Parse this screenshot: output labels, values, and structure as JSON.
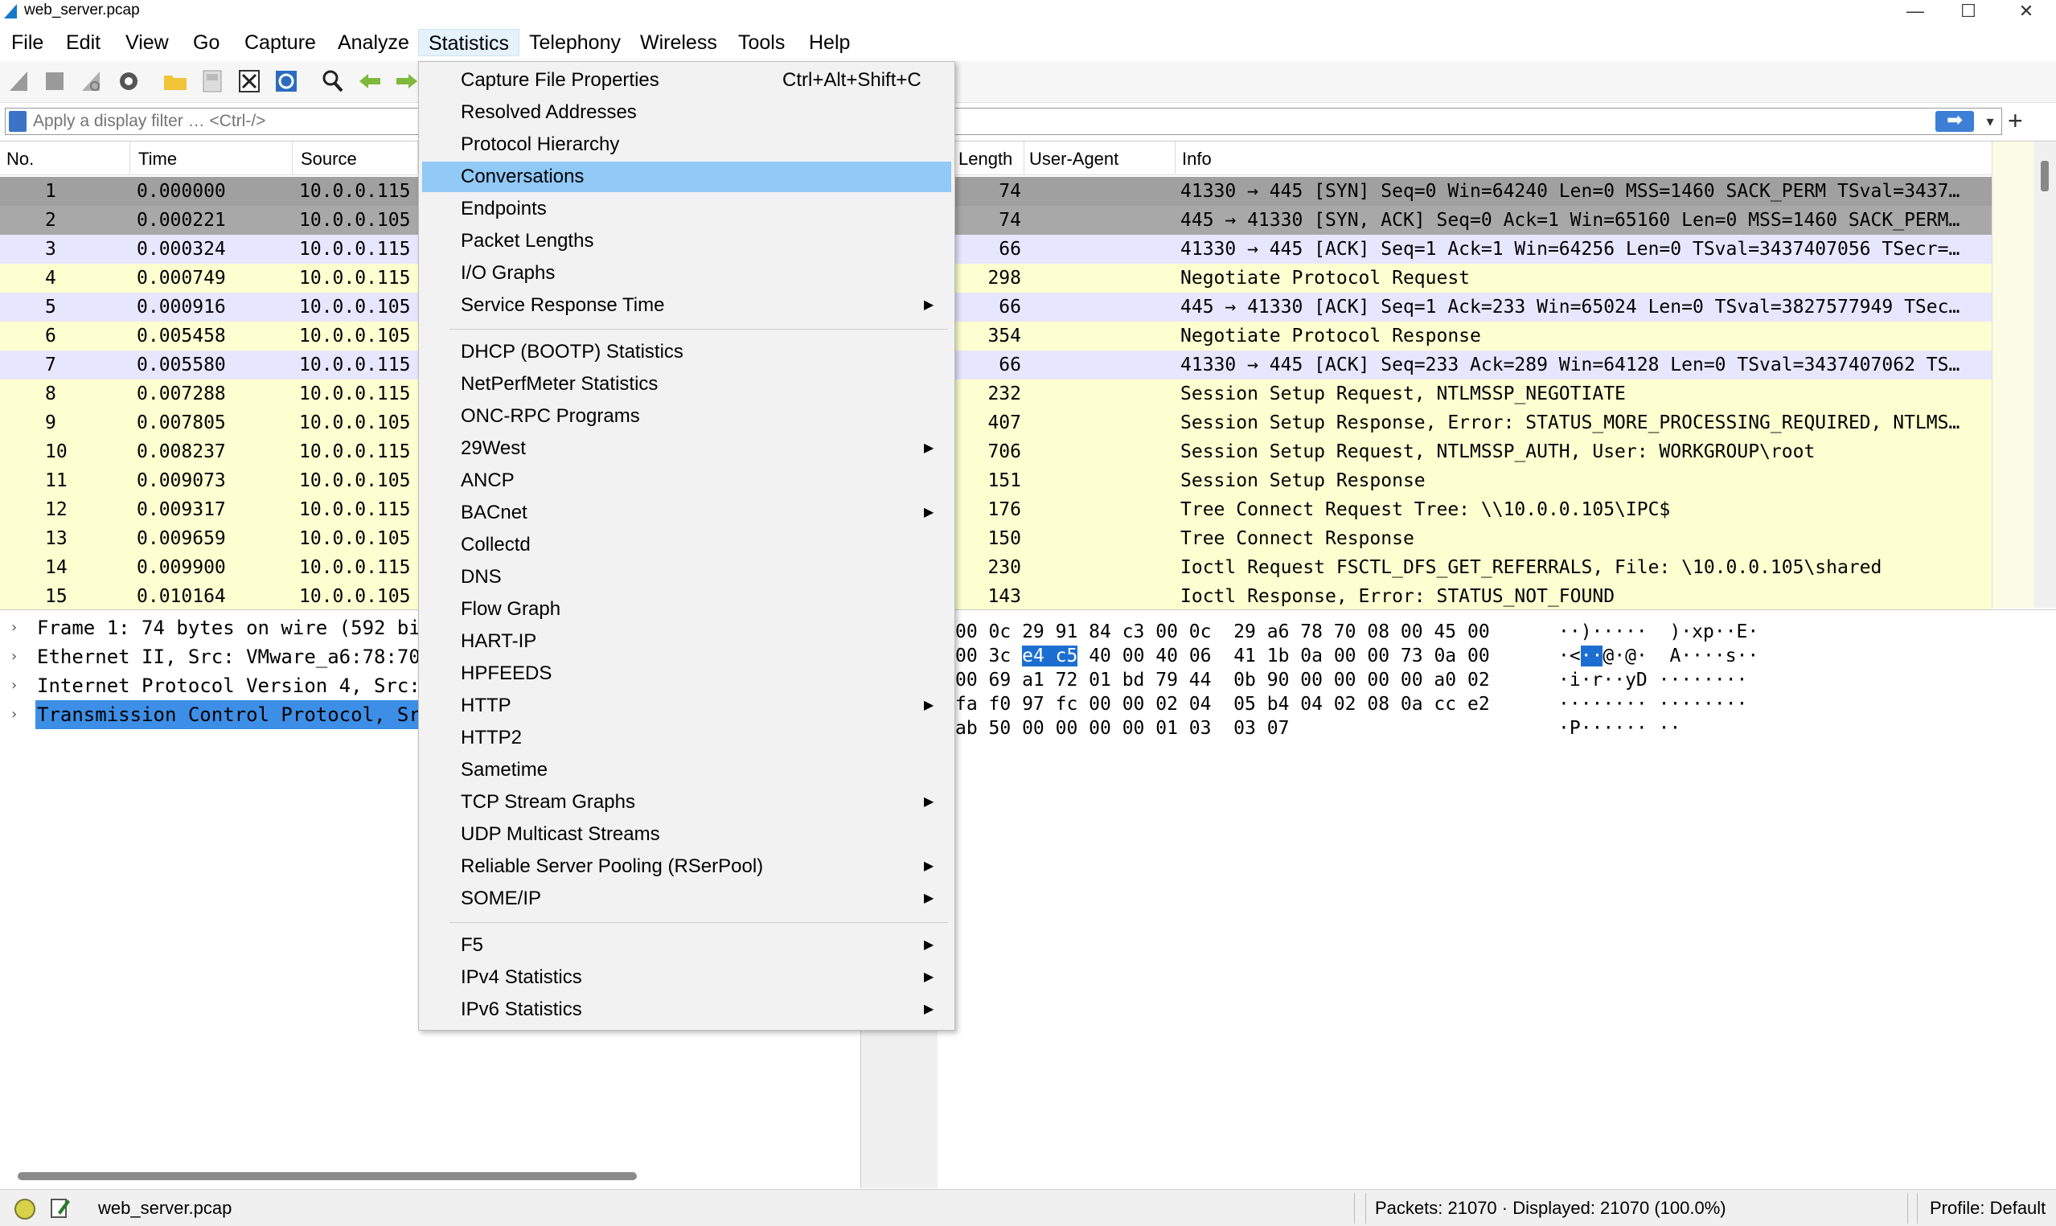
{
  "window": {
    "title": "web_server.pcap",
    "controls": {
      "minimize": "—",
      "maximize": "☐",
      "close": "✕"
    }
  },
  "menubar": [
    "File",
    "Edit",
    "View",
    "Go",
    "Capture",
    "Analyze",
    "Statistics",
    "Telephony",
    "Wireless",
    "Tools",
    "Help"
  ],
  "toolbar_icons": [
    "shark-fin-start-icon",
    "stop-icon",
    "restart-icon",
    "options-gear-icon",
    "open-folder-icon",
    "save-file-icon",
    "close-file-icon",
    "reload-icon",
    "find-magnifier-icon",
    "go-back-arrow-icon",
    "go-forward-arrow-icon"
  ],
  "filter": {
    "placeholder": "Apply a display filter … <Ctrl-/>",
    "apply_icon": "arrow-right-icon",
    "plus": "+"
  },
  "packet_list": {
    "columns": {
      "no": "No.",
      "time": "Time",
      "source": "Source",
      "length": "Length",
      "user_agent": "User-Agent",
      "info": "Info"
    },
    "rows": [
      {
        "no": "1",
        "time": "0.000000",
        "source": "10.0.0.115",
        "length": "74",
        "info": "41330 → 445 [SYN] Seq=0 Win=64240 Len=0 MSS=1460 SACK_PERM TSval=3437…",
        "style": "sel"
      },
      {
        "no": "2",
        "time": "0.000221",
        "source": "10.0.0.105",
        "length": "74",
        "info": "445 → 41330 [SYN, ACK] Seq=0 Ack=1 Win=65160 Len=0 MSS=1460 SACK_PERM…",
        "style": "sel2"
      },
      {
        "no": "3",
        "time": "0.000324",
        "source": "10.0.0.115",
        "length": "66",
        "info": "41330 → 445 [ACK] Seq=1 Ack=1 Win=64256 Len=0 TSval=3437407056 TSecr=…",
        "style": "tcp"
      },
      {
        "no": "4",
        "time": "0.000749",
        "source": "10.0.0.115",
        "length": "298",
        "info": "Negotiate Protocol Request",
        "style": "smb"
      },
      {
        "no": "5",
        "time": "0.000916",
        "source": "10.0.0.105",
        "length": "66",
        "info": "445 → 41330 [ACK] Seq=1 Ack=233 Win=65024 Len=0 TSval=3827577949 TSec…",
        "style": "tcp"
      },
      {
        "no": "6",
        "time": "0.005458",
        "source": "10.0.0.105",
        "length": "354",
        "info": "Negotiate Protocol Response",
        "style": "smb"
      },
      {
        "no": "7",
        "time": "0.005580",
        "source": "10.0.0.115",
        "length": "66",
        "info": "41330 → 445 [ACK] Seq=233 Ack=289 Win=64128 Len=0 TSval=3437407062 TS…",
        "style": "tcp"
      },
      {
        "no": "8",
        "time": "0.007288",
        "source": "10.0.0.115",
        "length": "232",
        "info": "Session Setup Request, NTLMSSP_NEGOTIATE",
        "style": "smb"
      },
      {
        "no": "9",
        "time": "0.007805",
        "source": "10.0.0.105",
        "length": "407",
        "info": "Session Setup Response, Error: STATUS_MORE_PROCESSING_REQUIRED, NTLMS…",
        "style": "smb"
      },
      {
        "no": "10",
        "time": "0.008237",
        "source": "10.0.0.115",
        "length": "706",
        "info": "Session Setup Request, NTLMSSP_AUTH, User: WORKGROUP\\root",
        "style": "smb"
      },
      {
        "no": "11",
        "time": "0.009073",
        "source": "10.0.0.105",
        "length": "151",
        "info": "Session Setup Response",
        "style": "smb"
      },
      {
        "no": "12",
        "time": "0.009317",
        "source": "10.0.0.115",
        "length": "176",
        "info": "Tree Connect Request Tree: \\\\10.0.0.105\\IPC$",
        "style": "smb"
      },
      {
        "no": "13",
        "time": "0.009659",
        "source": "10.0.0.105",
        "length": "150",
        "info": "Tree Connect Response",
        "style": "smb"
      },
      {
        "no": "14",
        "time": "0.009900",
        "source": "10.0.0.115",
        "length": "230",
        "info": "Ioctl Request FSCTL_DFS_GET_REFERRALS, File: \\10.0.0.105\\shared",
        "style": "smb"
      },
      {
        "no": "15",
        "time": "0.010164",
        "source": "10.0.0.105",
        "length": "143",
        "info": "Ioctl Response, Error: STATUS_NOT_FOUND",
        "style": "smb"
      }
    ]
  },
  "details": [
    {
      "text": "Frame 1: 74 bytes on wire (592 bi",
      "selected": false
    },
    {
      "text": "Ethernet II, Src: VMware_a6:78:70",
      "selected": false
    },
    {
      "text": "Internet Protocol Version 4, Src:",
      "selected": false
    },
    {
      "text": "Transmission Control Protocol, Sr",
      "selected": true
    }
  ],
  "bytes": [
    {
      "hex_pre": "00 0c 29 91 84 c3 00 0c  29 a6 78 70 08 00 45 00",
      "hl": "",
      "hex_post": "",
      "ascii_pre": "··)·····  )·xp··E·",
      "ascii_hl": "",
      "ascii_post": ""
    },
    {
      "hex_pre": "00 3c ",
      "hl": "e4 c5",
      "hex_post": " 40 00 40 06  41 1b 0a 00 00 73 0a 00",
      "ascii_pre": "·<",
      "ascii_hl": "··",
      "ascii_post": "@·@·  A····s··"
    },
    {
      "hex_pre": "00 69 a1 72 01 bd 79 44  0b 90 00 00 00 00 a0 02",
      "hl": "",
      "hex_post": "",
      "ascii_pre": "·i·r··yD ········",
      "ascii_hl": "",
      "ascii_post": ""
    },
    {
      "hex_pre": "fa f0 97 fc 00 00 02 04  05 b4 04 02 08 0a cc e2",
      "hl": "",
      "hex_post": "",
      "ascii_pre": "········ ········",
      "ascii_hl": "",
      "ascii_post": ""
    },
    {
      "hex_pre": "ab 50 00 00 00 00 01 03  03 07",
      "hl": "",
      "hex_post": "",
      "ascii_pre": "·P······ ··",
      "ascii_hl": "",
      "ascii_post": ""
    }
  ],
  "status": {
    "file": "web_server.pcap",
    "packets": "Packets: 21070 · Displayed: 21070 (100.0%)",
    "profile": "Profile: Default"
  },
  "statistics_menu": [
    {
      "label": "Capture File Properties",
      "shortcut": "Ctrl+Alt+Shift+C",
      "sub": false
    },
    {
      "label": "Resolved Addresses",
      "shortcut": "",
      "sub": false
    },
    {
      "label": "Protocol Hierarchy",
      "shortcut": "",
      "sub": false
    },
    {
      "label": "Conversations",
      "shortcut": "",
      "sub": false,
      "highlight": true
    },
    {
      "label": "Endpoints",
      "shortcut": "",
      "sub": false
    },
    {
      "label": "Packet Lengths",
      "shortcut": "",
      "sub": false
    },
    {
      "label": "I/O Graphs",
      "shortcut": "",
      "sub": false
    },
    {
      "label": "Service Response Time",
      "shortcut": "",
      "sub": true
    },
    {
      "sep": true
    },
    {
      "label": "DHCP (BOOTP) Statistics",
      "shortcut": "",
      "sub": false
    },
    {
      "label": "NetPerfMeter Statistics",
      "shortcut": "",
      "sub": false
    },
    {
      "label": "ONC-RPC Programs",
      "shortcut": "",
      "sub": false
    },
    {
      "label": "29West",
      "shortcut": "",
      "sub": true
    },
    {
      "label": "ANCP",
      "shortcut": "",
      "sub": false
    },
    {
      "label": "BACnet",
      "shortcut": "",
      "sub": true
    },
    {
      "label": "Collectd",
      "shortcut": "",
      "sub": false
    },
    {
      "label": "DNS",
      "shortcut": "",
      "sub": false
    },
    {
      "label": "Flow Graph",
      "shortcut": "",
      "sub": false
    },
    {
      "label": "HART-IP",
      "shortcut": "",
      "sub": false
    },
    {
      "label": "HPFEEDS",
      "shortcut": "",
      "sub": false
    },
    {
      "label": "HTTP",
      "shortcut": "",
      "sub": true
    },
    {
      "label": "HTTP2",
      "shortcut": "",
      "sub": false
    },
    {
      "label": "Sametime",
      "shortcut": "",
      "sub": false
    },
    {
      "label": "TCP Stream Graphs",
      "shortcut": "",
      "sub": true
    },
    {
      "label": "UDP Multicast Streams",
      "shortcut": "",
      "sub": false
    },
    {
      "label": "Reliable Server Pooling (RSerPool)",
      "shortcut": "",
      "sub": true
    },
    {
      "label": "SOME/IP",
      "shortcut": "",
      "sub": true
    },
    {
      "sep": true
    },
    {
      "label": "F5",
      "shortcut": "",
      "sub": true
    },
    {
      "label": "IPv4 Statistics",
      "shortcut": "",
      "sub": true
    },
    {
      "label": "IPv6 Statistics",
      "shortcut": "",
      "sub": true
    }
  ],
  "colors": {
    "row_tcp": "#e7e6ff",
    "row_smb": "#feffd0",
    "row_selected": "#a0a0a0",
    "menu_highlight": "#91c9f7",
    "detail_selected": "#3d8ee6"
  }
}
